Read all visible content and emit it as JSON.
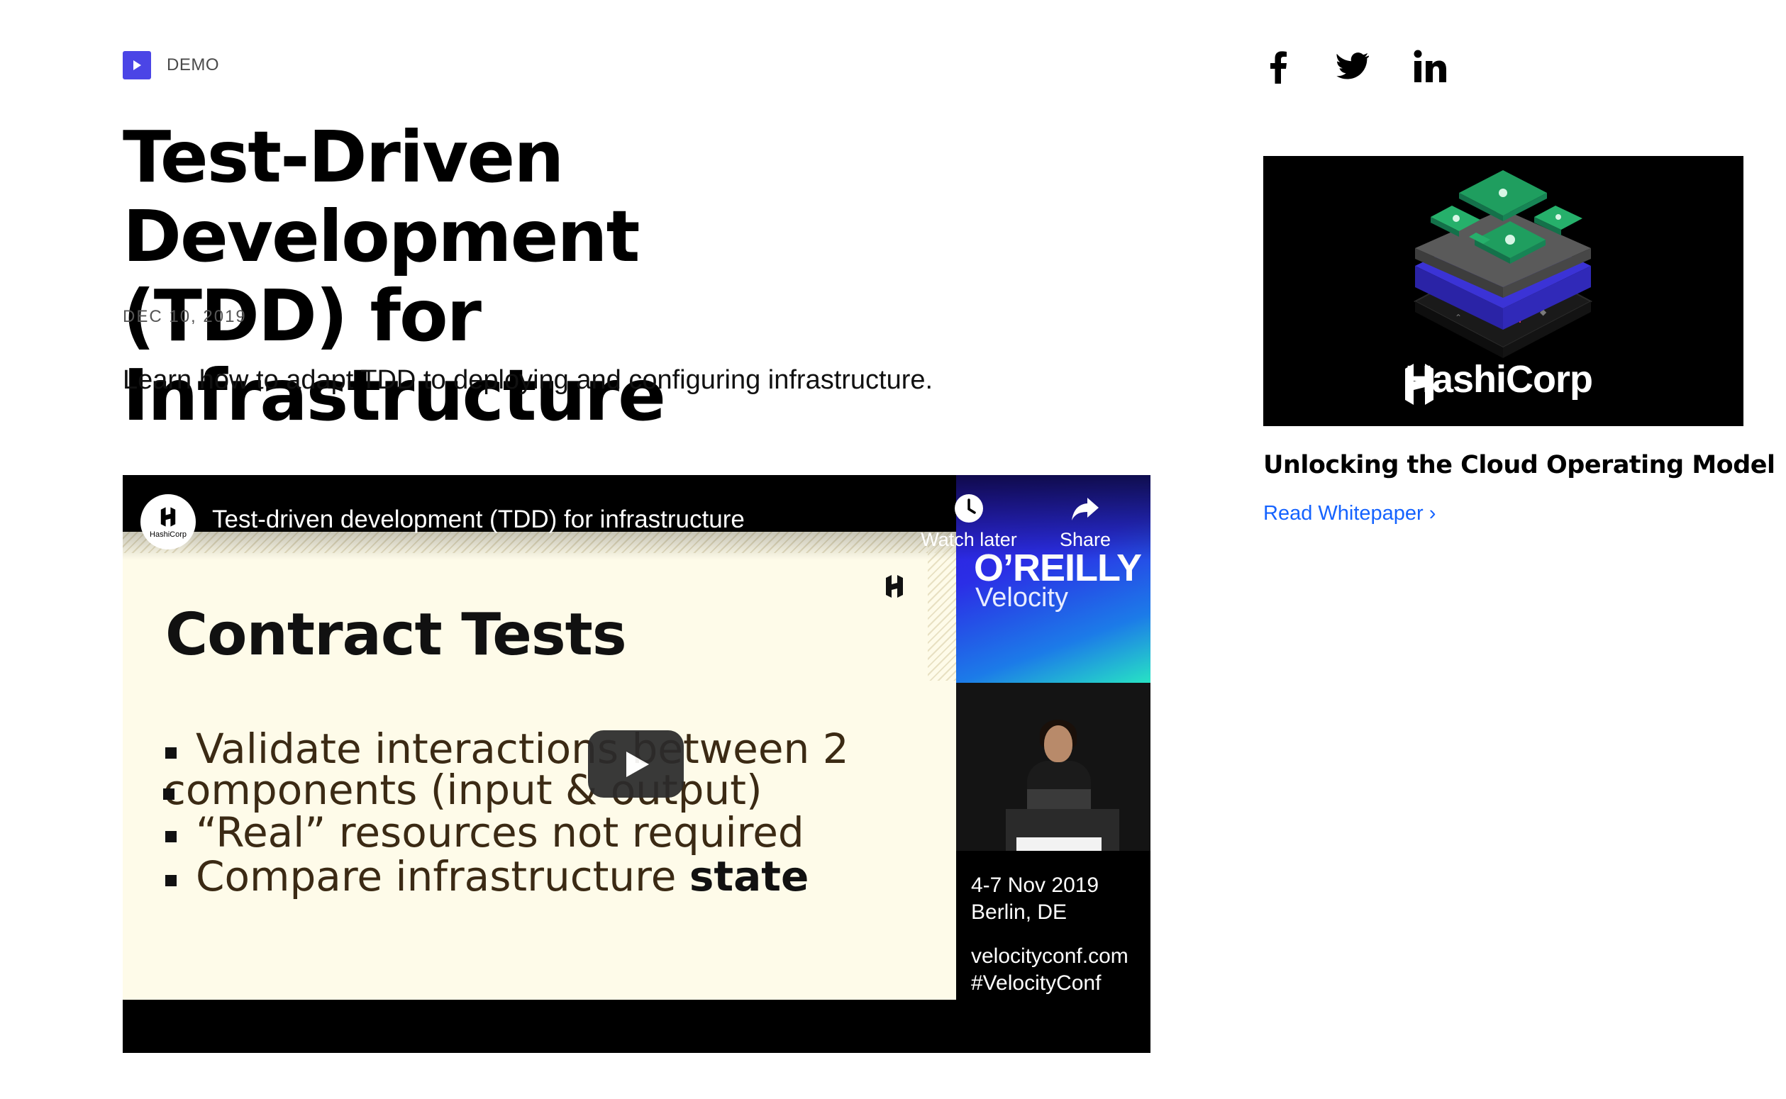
{
  "article": {
    "badge_label": "DEMO",
    "title_line1": "Test-Driven Development",
    "title_line2": "(TDD) for Infrastructure",
    "date": "DEC 10, 2019",
    "description": "Learn how to adapt TDD to deploying and configuring infrastructure."
  },
  "video": {
    "title": "Test-driven development (TDD) for infrastructure",
    "channel_name": "HashiCorp",
    "watch_later_label": "Watch later",
    "share_label": "Share",
    "slide": {
      "title": "Contract Tests",
      "bullet1_line1": "Validate interactions between 2",
      "bullet1_line2": "components (input & output)",
      "bullet2": "“Real” resources not required",
      "bullet3_plain": "Compare infrastructure ",
      "bullet3_bold": "state"
    },
    "sidebar": {
      "brand": "O’REILLY",
      "event": "Velocity",
      "dates": "4-7 Nov 2019",
      "location": "Berlin, DE",
      "url": "velocityconf.com",
      "hashtag": "#VelocityConf"
    }
  },
  "social": {
    "icons": [
      "facebook-icon",
      "twitter-icon",
      "linkedin-icon"
    ]
  },
  "promo": {
    "brand": "HashiCorp",
    "title": "Unlocking the Cloud Operating Model",
    "link_label": "Read Whitepaper ›"
  },
  "colors": {
    "accent": "#4b45e6",
    "link": "#1563ff",
    "slide_bg": "#fefbe9",
    "green": "#1f9e5f"
  }
}
